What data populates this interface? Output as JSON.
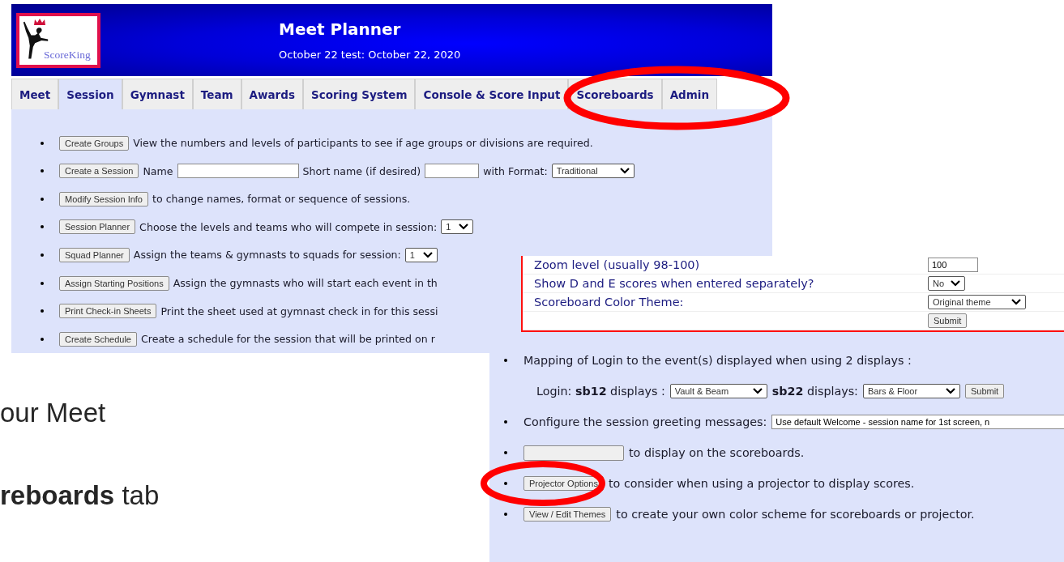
{
  "screenshot_1": {
    "logo": {
      "text": "ScoreKing"
    },
    "header": {
      "title": "Meet Planner",
      "subtitle": "October 22 test: October 22, 2020"
    },
    "tabs": [
      {
        "label": "Meet",
        "selected": false
      },
      {
        "label": "Session",
        "selected": true
      },
      {
        "label": "Gymnast",
        "selected": false
      },
      {
        "label": "Team",
        "selected": false
      },
      {
        "label": "Awards",
        "selected": false
      },
      {
        "label": "Scoring System",
        "selected": false
      },
      {
        "label": "Console & Score Input",
        "selected": false
      },
      {
        "label": "Scoreboards",
        "selected": false
      },
      {
        "label": "Admin",
        "selected": false
      }
    ],
    "rows": [
      {
        "pieces": [
          {
            "kind": "button",
            "text": "Create Groups"
          },
          {
            "kind": "text",
            "text": "View the numbers and levels of participants to see if age groups or divisions are required."
          }
        ]
      },
      {
        "pieces": [
          {
            "kind": "button",
            "text": "Create a Session"
          },
          {
            "kind": "text",
            "text": "Name"
          },
          {
            "kind": "input"
          },
          {
            "kind": "text",
            "text": "Short name (if desired)"
          },
          {
            "kind": "input"
          },
          {
            "kind": "text",
            "text": "with Format:"
          },
          {
            "kind": "select",
            "text": "Traditional"
          }
        ]
      },
      {
        "pieces": [
          {
            "kind": "button",
            "text": "Modify Session Info"
          },
          {
            "kind": "text",
            "text": "to change names, format or sequence of sessions."
          }
        ]
      },
      {
        "pieces": [
          {
            "kind": "button",
            "text": "Session Planner"
          },
          {
            "kind": "text",
            "text": "Choose the levels and teams who will compete in session:"
          },
          {
            "kind": "select",
            "text": "1"
          }
        ]
      },
      {
        "pieces": [
          {
            "kind": "button",
            "text": "Squad Planner"
          },
          {
            "kind": "text",
            "text": "Assign the teams & gymnasts to squads for session:"
          },
          {
            "kind": "select",
            "text": "1"
          }
        ]
      },
      {
        "pieces": [
          {
            "kind": "button",
            "text": "Assign Starting Positions"
          },
          {
            "kind": "text",
            "text": "Assign the gymnasts who will start each event in th"
          }
        ]
      },
      {
        "pieces": [
          {
            "kind": "button",
            "text": "Print Check-in Sheets"
          },
          {
            "kind": "text",
            "text": "Print the sheet used at gymnast check in for this sessi"
          }
        ]
      },
      {
        "pieces": [
          {
            "kind": "button",
            "text": "Create Schedule"
          },
          {
            "kind": "text",
            "text": "Create a schedule for the session that will be printed on r"
          }
        ]
      }
    ]
  },
  "screenshot_2": {
    "settings_table": [
      {
        "label": "Zoom level (usually 98-100)",
        "control": {
          "kind": "input",
          "text": "100"
        }
      },
      {
        "label": "Show D and E scores when entered separately?",
        "control": {
          "kind": "select",
          "text": "No"
        }
      },
      {
        "label": "Scoreboard Color Theme:",
        "control": {
          "kind": "select",
          "text": "Original theme"
        }
      },
      {
        "control": {
          "kind": "button",
          "text": "Submit"
        }
      }
    ],
    "items": [
      {
        "kind": "bullet",
        "pieces": [
          {
            "kind": "text",
            "text": "Mapping of Login to the event(s) displayed when using 2 displays :"
          }
        ]
      },
      {
        "kind": "indent",
        "pieces": [
          {
            "kind": "text",
            "text": "Login: **sb12** displays :"
          },
          {
            "kind": "select",
            "text": "Vault & Beam"
          },
          {
            "kind": "text",
            "text": "**sb22** displays:"
          },
          {
            "kind": "select",
            "text": "Bars & Floor"
          },
          {
            "kind": "button",
            "text": "Submit"
          }
        ]
      },
      {
        "kind": "bullet",
        "pieces": [
          {
            "kind": "text",
            "text": "Configure the session greeting messages:"
          },
          {
            "kind": "input",
            "text": "Use default Welcome - session name for 1st screen, n"
          }
        ]
      },
      {
        "kind": "bullet",
        "pieces": [
          {
            "kind": "button"
          },
          {
            "kind": "text",
            "text": "to display on the scoreboards."
          }
        ]
      },
      {
        "kind": "bullet",
        "pieces": [
          {
            "kind": "button",
            "text": "Projector Options"
          },
          {
            "kind": "text",
            "text": "to consider when using a projector to display scores."
          }
        ]
      },
      {
        "kind": "bullet",
        "pieces": [
          {
            "kind": "button",
            "text": "View / Edit Themes"
          },
          {
            "kind": "text",
            "text": "to create your own color scheme for scoreboards or projector."
          }
        ]
      }
    ]
  },
  "slide_text": [
    {
      "text": "our Meet"
    },
    {
      "text": "**reboards** tab"
    }
  ]
}
